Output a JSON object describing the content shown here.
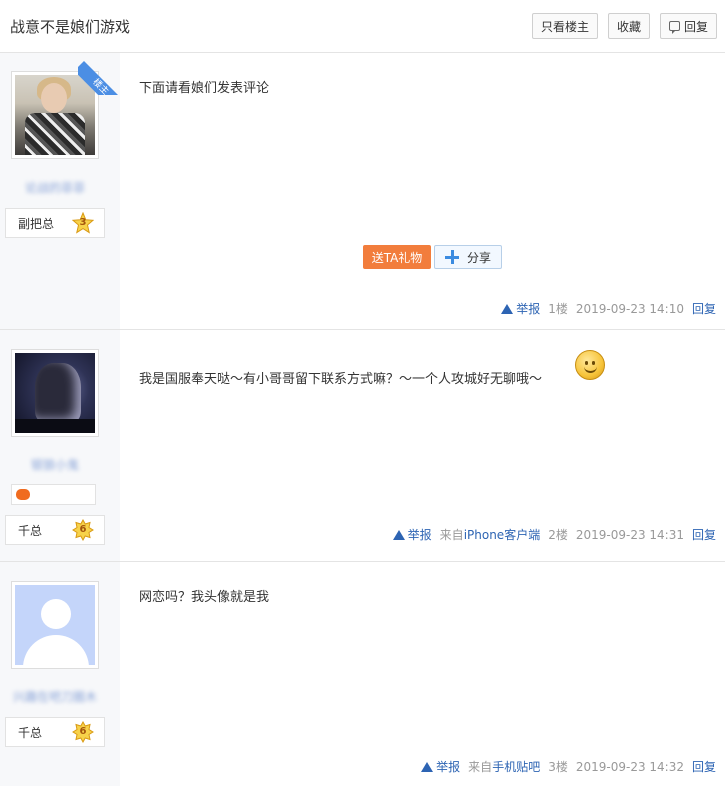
{
  "header": {
    "title": "战意不是娘们游戏",
    "only_op_label": "只看楼主",
    "favorite_label": "收藏",
    "reply_label": "回复"
  },
  "posts": [
    {
      "op_tag": "楼主",
      "username": "论战的菲菲",
      "rank": "副把总",
      "level": "3",
      "text": "下面请看娘们发表评论",
      "gift_label": "送TA礼物",
      "share_label": "分享",
      "report_label": "举报",
      "source_prefix": "",
      "source_client": "",
      "floor": "1楼",
      "time": "2019-09-23 14:10",
      "reply_label": "回复"
    },
    {
      "username": "银狼小鬼",
      "rank": "千总",
      "level": "6",
      "text": "我是国服奉天哒～有小哥哥留下联系方式嘛？～一个人攻城好无聊哦～",
      "report_label": "举报",
      "source_prefix": "来自",
      "source_client": "iPhone客户端",
      "floor": "2楼",
      "time": "2019-09-23 14:31",
      "reply_label": "回复"
    },
    {
      "username": "兴趣在吧刀圈木",
      "rank": "千总",
      "level": "6",
      "text": "网恋吗？我头像就是我",
      "report_label": "举报",
      "source_prefix": "来自",
      "source_client": "手机贴吧",
      "floor": "3楼",
      "time": "2019-09-23 14:32",
      "reply_label": "回复"
    }
  ],
  "colors": {
    "link": "#2d64b3",
    "gift": "#f27d3c",
    "ribbon": "#4b8ee4",
    "sidebar": "#f7f8fa"
  }
}
